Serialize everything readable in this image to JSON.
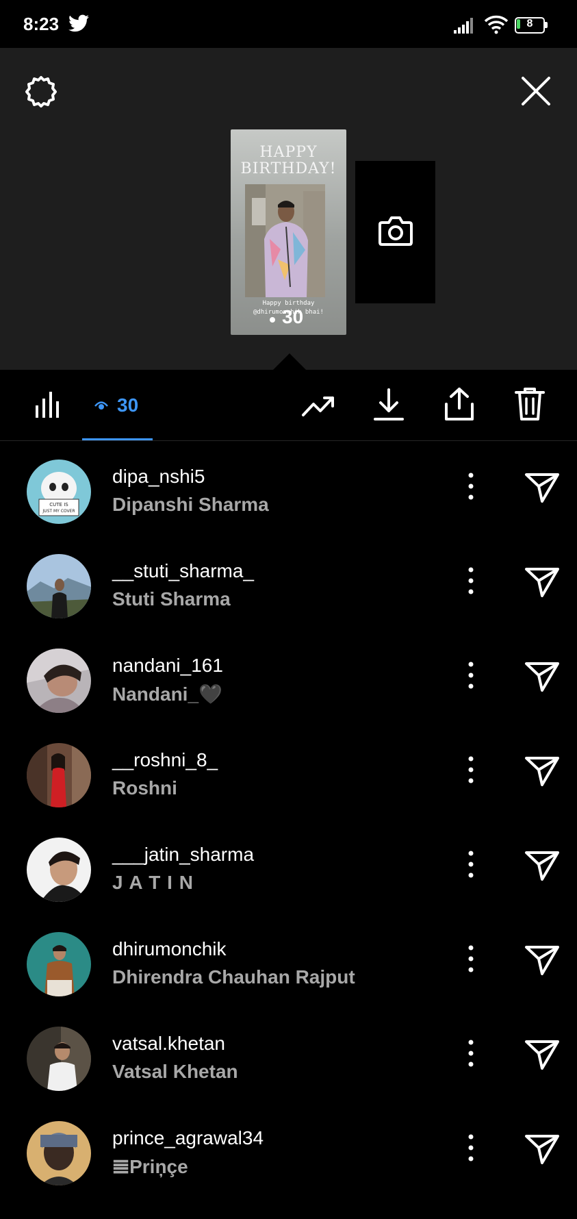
{
  "status_bar": {
    "time": "8:23",
    "battery": "8",
    "icons": [
      "twitter-icon",
      "signal-icon",
      "wifi-icon",
      "battery-icon"
    ]
  },
  "header": {
    "icons": [
      "gear-icon",
      "close-icon"
    ]
  },
  "story": {
    "greeting_line1": "HAPPY",
    "greeting_line2": "BIRTHDAY!",
    "caption_line1": "Happy birthday",
    "caption_line2": "@dhirumonchik bhai!",
    "views": "30"
  },
  "toolbar": {
    "views_count": "30",
    "active_tab": "viewers",
    "accent_color": "#3d95f5",
    "icons": [
      "insights-icon",
      "eye-icon",
      "promote-icon",
      "download-icon",
      "share-icon",
      "delete-icon"
    ]
  },
  "viewers": [
    {
      "username": "dipa_nshi5",
      "name": "Dipanshi Sharma"
    },
    {
      "username": "__stuti_sharma_",
      "name": "Stuti Sharma"
    },
    {
      "username": "nandani_161",
      "name": "Nandani_🖤"
    },
    {
      "username": "__roshni_8_",
      "name": "Roshni"
    },
    {
      "username": "___jatin_sharma",
      "name": "J A T I N"
    },
    {
      "username": "dhirumonchik",
      "name": "Dhirendra Chauhan Rajput"
    },
    {
      "username": "vatsal.khetan",
      "name": "Vatsal Khetan"
    },
    {
      "username": "prince_agrawal34",
      "name": "𝌆Priņçe"
    }
  ]
}
